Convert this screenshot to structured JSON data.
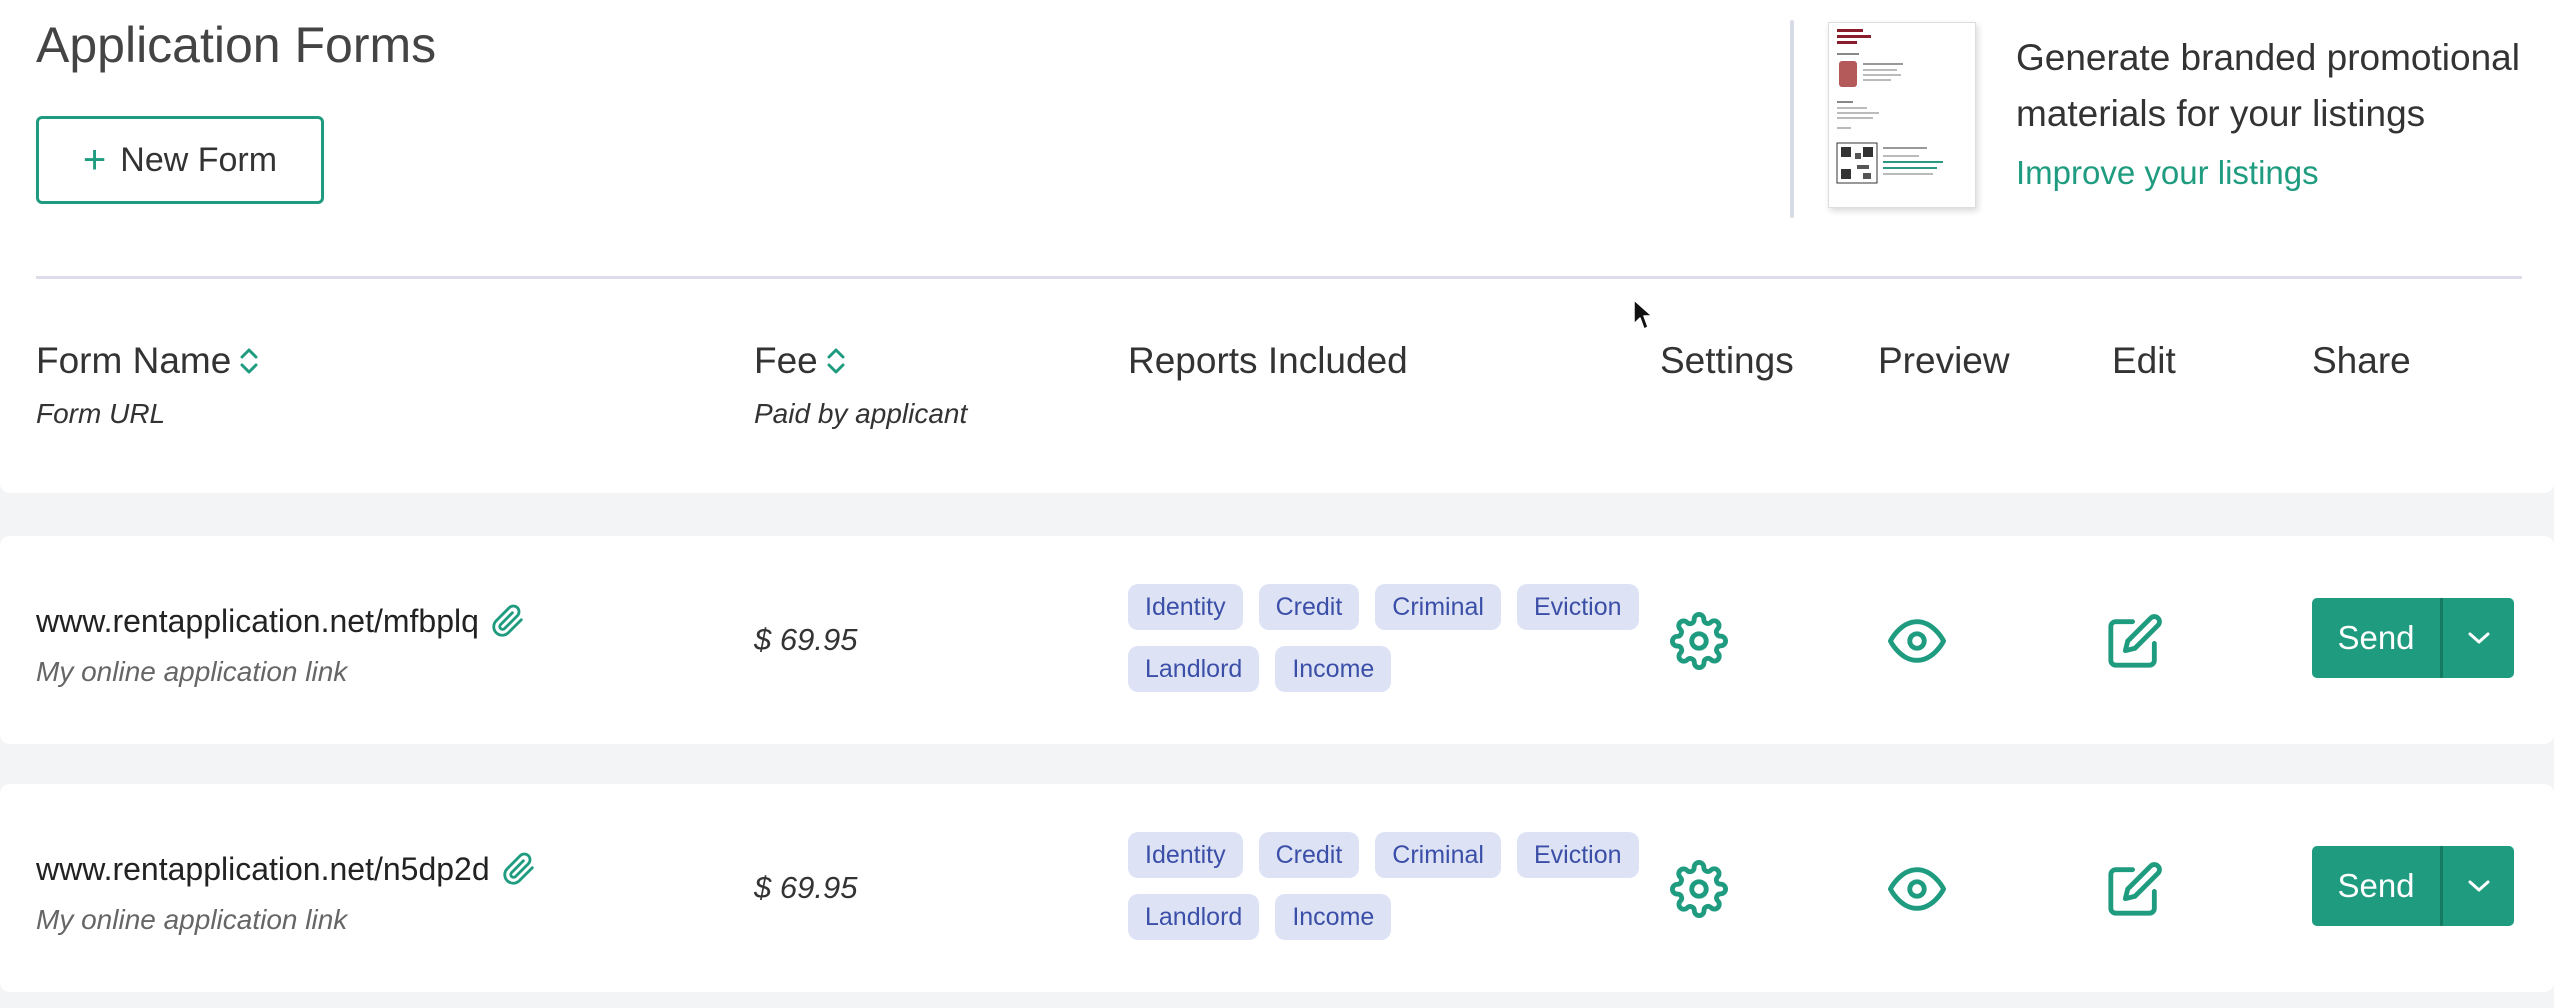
{
  "header": {
    "title": "Application Forms",
    "new_form_label": "New Form"
  },
  "promo": {
    "text": "Generate branded promotional materials for your listings",
    "link": "Improve your listings"
  },
  "table": {
    "columns": {
      "form_name": "Form Name",
      "form_name_sub": "Form URL",
      "fee": "Fee",
      "fee_sub": "Paid by applicant",
      "reports": "Reports Included",
      "settings": "Settings",
      "preview": "Preview",
      "edit": "Edit",
      "share": "Share"
    },
    "rows": [
      {
        "url": "www.rentapplication.net/mfbplq",
        "description": "My online application link",
        "fee": "$ 69.95",
        "reports": [
          "Identity",
          "Credit",
          "Criminal",
          "Eviction",
          "Landlord",
          "Income"
        ],
        "send_label": "Send"
      },
      {
        "url": "www.rentapplication.net/n5dp2d",
        "description": "My online application link",
        "fee": "$ 69.95",
        "reports": [
          "Identity",
          "Credit",
          "Criminal",
          "Eviction",
          "Landlord",
          "Income"
        ],
        "send_label": "Send"
      }
    ]
  },
  "colors": {
    "accent": "#1f9c7f",
    "tag_bg": "#dde3f5",
    "tag_text": "#3b4fa8",
    "page_bg": "#f3f4f6"
  },
  "icons": {
    "sort": "sort-icon",
    "attachment": "paperclip-icon",
    "settings": "gear-icon",
    "preview": "eye-icon",
    "edit": "edit-icon",
    "dropdown": "chevron-down-icon",
    "plus": "plus-icon"
  }
}
